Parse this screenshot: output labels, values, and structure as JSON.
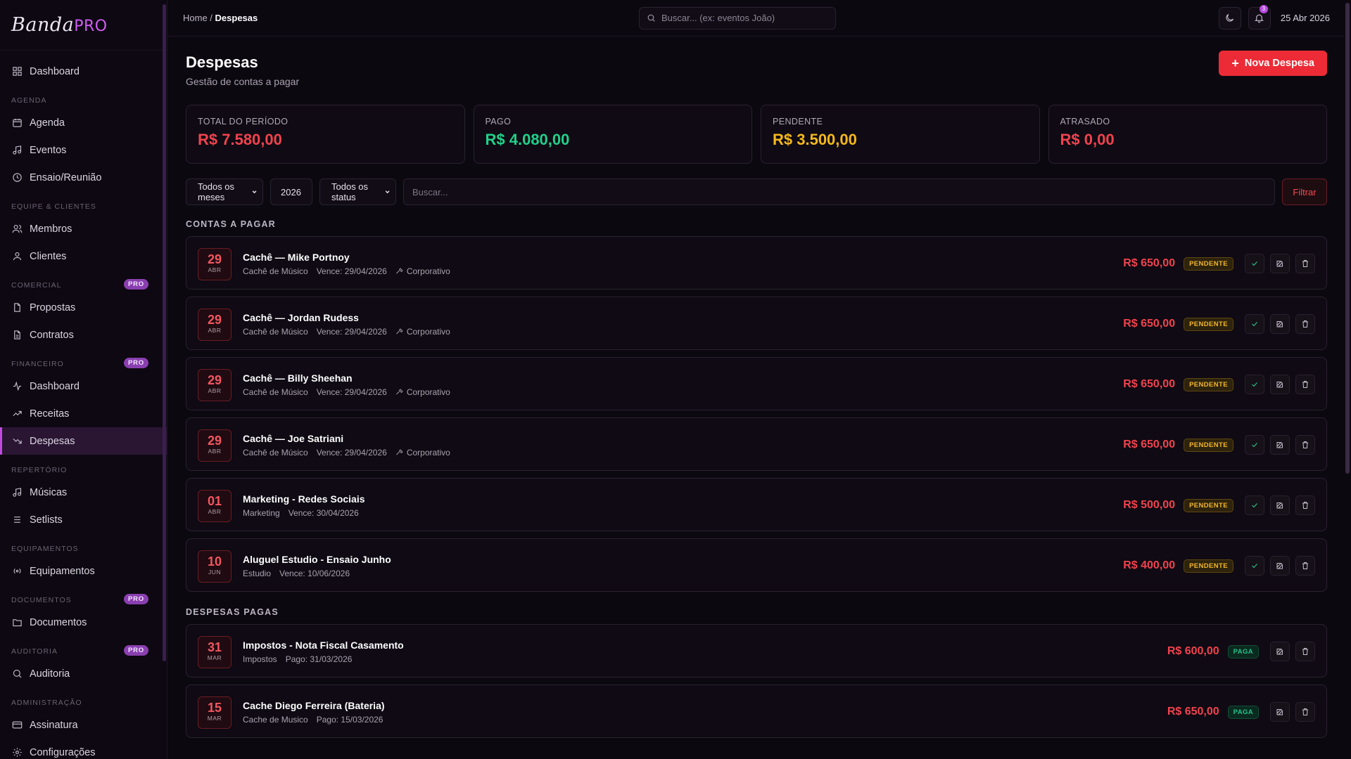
{
  "brand": {
    "name": "Banda",
    "pro": "PRO"
  },
  "sidebar": {
    "items": [
      {
        "type": "item",
        "label": "Dashboard",
        "icon": "grid-icon",
        "name": "sidebar-item-dashboard"
      },
      {
        "type": "section",
        "label": "AGENDA"
      },
      {
        "type": "item",
        "label": "Agenda",
        "icon": "calendar-icon",
        "name": "sidebar-item-agenda"
      },
      {
        "type": "item",
        "label": "Eventos",
        "icon": "music-note-icon",
        "name": "sidebar-item-eventos"
      },
      {
        "type": "item",
        "label": "Ensaio/Reunião",
        "icon": "clock-icon",
        "name": "sidebar-item-ensaio"
      },
      {
        "type": "section",
        "label": "EQUIPE & CLIENTES"
      },
      {
        "type": "item",
        "label": "Membros",
        "icon": "users-icon",
        "name": "sidebar-item-membros"
      },
      {
        "type": "item",
        "label": "Clientes",
        "icon": "user-icon",
        "name": "sidebar-item-clientes"
      },
      {
        "type": "section",
        "label": "COMERCIAL",
        "badge": "PRO"
      },
      {
        "type": "item",
        "label": "Propostas",
        "icon": "file-icon",
        "name": "sidebar-item-propostas"
      },
      {
        "type": "item",
        "label": "Contratos",
        "icon": "file-text-icon",
        "name": "sidebar-item-contratos"
      },
      {
        "type": "section",
        "label": "FINANCEIRO",
        "badge": "PRO"
      },
      {
        "type": "item",
        "label": "Dashboard",
        "icon": "activity-icon",
        "name": "sidebar-item-fin-dashboard"
      },
      {
        "type": "item",
        "label": "Receitas",
        "icon": "trending-up-icon",
        "name": "sidebar-item-receitas"
      },
      {
        "type": "item",
        "label": "Despesas",
        "icon": "trending-down-icon",
        "name": "sidebar-item-despesas",
        "active": true
      },
      {
        "type": "section",
        "label": "REPERTÓRIO"
      },
      {
        "type": "item",
        "label": "Músicas",
        "icon": "music-note-icon",
        "name": "sidebar-item-musicas"
      },
      {
        "type": "item",
        "label": "Setlists",
        "icon": "list-icon",
        "name": "sidebar-item-setlists"
      },
      {
        "type": "section",
        "label": "EQUIPAMENTOS"
      },
      {
        "type": "item",
        "label": "Equipamentos",
        "icon": "broadcast-icon",
        "name": "sidebar-item-equipamentos"
      },
      {
        "type": "section",
        "label": "DOCUMENTOS",
        "badge": "PRO"
      },
      {
        "type": "item",
        "label": "Documentos",
        "icon": "folder-icon",
        "name": "sidebar-item-documentos"
      },
      {
        "type": "section",
        "label": "AUDITORIA",
        "badge": "PRO"
      },
      {
        "type": "item",
        "label": "Auditoria",
        "icon": "search-icon",
        "name": "sidebar-item-auditoria"
      },
      {
        "type": "section",
        "label": "ADMINISTRAÇÃO"
      },
      {
        "type": "item",
        "label": "Assinatura",
        "icon": "card-icon",
        "name": "sidebar-item-assinatura"
      },
      {
        "type": "item",
        "label": "Configurações",
        "icon": "gear-icon",
        "name": "sidebar-item-configuracoes"
      }
    ]
  },
  "topbar": {
    "breadcrumb_home": "Home",
    "breadcrumb_sep": " / ",
    "breadcrumb_current": "Despesas",
    "search_placeholder": "Buscar... (ex: eventos João)",
    "notif_count": "3",
    "date": "25 Abr 2026"
  },
  "page": {
    "title": "Despesas",
    "subtitle": "Gestão de contas a pagar",
    "new_button": "Nova Despesa"
  },
  "stats": [
    {
      "label": "TOTAL DO PERÍODO",
      "value": "R$ 7.580,00",
      "color": "#f0434e"
    },
    {
      "label": "PAGO",
      "value": "R$ 4.080,00",
      "color": "#22d08a"
    },
    {
      "label": "PENDENTE",
      "value": "R$ 3.500,00",
      "color": "#f5b81d"
    },
    {
      "label": "ATRASADO",
      "value": "R$ 0,00",
      "color": "#f0434e"
    }
  ],
  "filters": {
    "month": "Todos os meses",
    "year": "2026",
    "status": "Todos os status",
    "search_placeholder": "Buscar...",
    "filter_button": "Filtrar"
  },
  "sections": {
    "pending_title": "CONTAS A PAGAR",
    "paid_title": "DESPESAS PAGAS"
  },
  "pending": [
    {
      "day": "29",
      "month": "ABR",
      "title": "Cachê — Mike Portnoy",
      "category": "Cachê de Músico",
      "due": "Vence: 29/04/2026",
      "tag": "Corporativo",
      "amount": "R$ 650,00",
      "status": "PENDENTE"
    },
    {
      "day": "29",
      "month": "ABR",
      "title": "Cachê — Jordan Rudess",
      "category": "Cachê de Músico",
      "due": "Vence: 29/04/2026",
      "tag": "Corporativo",
      "amount": "R$ 650,00",
      "status": "PENDENTE"
    },
    {
      "day": "29",
      "month": "ABR",
      "title": "Cachê — Billy Sheehan",
      "category": "Cachê de Músico",
      "due": "Vence: 29/04/2026",
      "tag": "Corporativo",
      "amount": "R$ 650,00",
      "status": "PENDENTE"
    },
    {
      "day": "29",
      "month": "ABR",
      "title": "Cachê — Joe Satriani",
      "category": "Cachê de Músico",
      "due": "Vence: 29/04/2026",
      "tag": "Corporativo",
      "amount": "R$ 650,00",
      "status": "PENDENTE"
    },
    {
      "day": "01",
      "month": "ABR",
      "title": "Marketing - Redes Sociais",
      "category": "Marketing",
      "due": "Vence: 30/04/2026",
      "tag": "",
      "amount": "R$ 500,00",
      "status": "PENDENTE"
    },
    {
      "day": "10",
      "month": "JUN",
      "title": "Aluguel Estudio - Ensaio Junho",
      "category": "Estudio",
      "due": "Vence: 10/06/2026",
      "tag": "",
      "amount": "R$ 400,00",
      "status": "PENDENTE"
    }
  ],
  "paid": [
    {
      "day": "31",
      "month": "MAR",
      "title": "Impostos - Nota Fiscal Casamento",
      "category": "Impostos",
      "due": "Pago: 31/03/2026",
      "tag": "",
      "amount": "R$ 600,00",
      "status": "PAGA"
    },
    {
      "day": "15",
      "month": "MAR",
      "title": "Cache Diego Ferreira (Bateria)",
      "category": "Cache de Musico",
      "due": "Pago: 15/03/2026",
      "tag": "",
      "amount": "R$ 650,00",
      "status": "PAGA"
    }
  ]
}
